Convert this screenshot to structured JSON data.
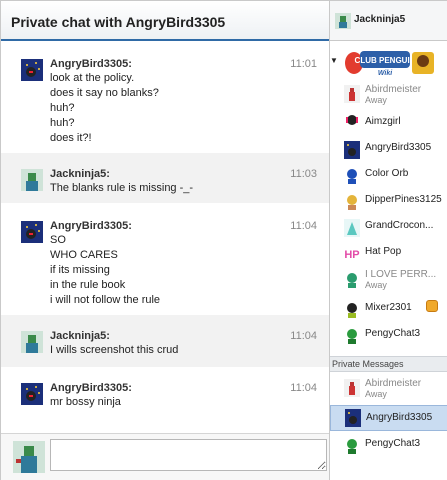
{
  "header": {
    "title": "Private chat with AngryBird3305",
    "current_user": "Jackninja5"
  },
  "messages": [
    {
      "author": "AngryBird3305:",
      "time": "11:01",
      "lines": [
        "look at the policy.",
        "does it say no blanks?",
        "huh?",
        "huh?",
        "does it?!"
      ]
    },
    {
      "author": "Jackninja5:",
      "time": "11:03",
      "lines": [
        "The blanks rule is missing -_-"
      ]
    },
    {
      "author": "AngryBird3305:",
      "time": "11:04",
      "lines": [
        "SO",
        "WHO CARES",
        "if its missing",
        "in the rule book",
        "i will not follow the rule"
      ]
    },
    {
      "author": "Jackninja5:",
      "time": "11:04",
      "lines": [
        "I wills screenshot this crud"
      ]
    },
    {
      "author": "AngryBird3305:",
      "time": "11:04",
      "lines": [
        "mr bossy ninja"
      ]
    }
  ],
  "input": {
    "value": "",
    "placeholder": ""
  },
  "sidebar": {
    "logo_text": "CLUB PENGUIN",
    "logo_subtext": "Wiki",
    "users": [
      {
        "name": "Abirdmeister",
        "status": "Away"
      },
      {
        "name": "Aimzgirl",
        "status": ""
      },
      {
        "name": "AngryBird3305",
        "status": ""
      },
      {
        "name": "Color Orb",
        "status": ""
      },
      {
        "name": "DipperPines3125",
        "status": ""
      },
      {
        "name": "GrandCrocon...",
        "status": ""
      },
      {
        "name": "Hat Pop",
        "status": ""
      },
      {
        "name": "I LOVE PERR...",
        "status": "Away"
      },
      {
        "name": "Mixer2301",
        "status": ""
      },
      {
        "name": "PengyChat3",
        "status": ""
      }
    ],
    "private_messages_label": "Private Messages",
    "private_messages": [
      {
        "name": "Abirdmeister",
        "status": "Away"
      },
      {
        "name": "AngryBird3305",
        "status": ""
      },
      {
        "name": "PengyChat3",
        "status": ""
      }
    ]
  },
  "colors": {
    "accent": "#2f6aa6",
    "selected": "#c9dcf1"
  }
}
